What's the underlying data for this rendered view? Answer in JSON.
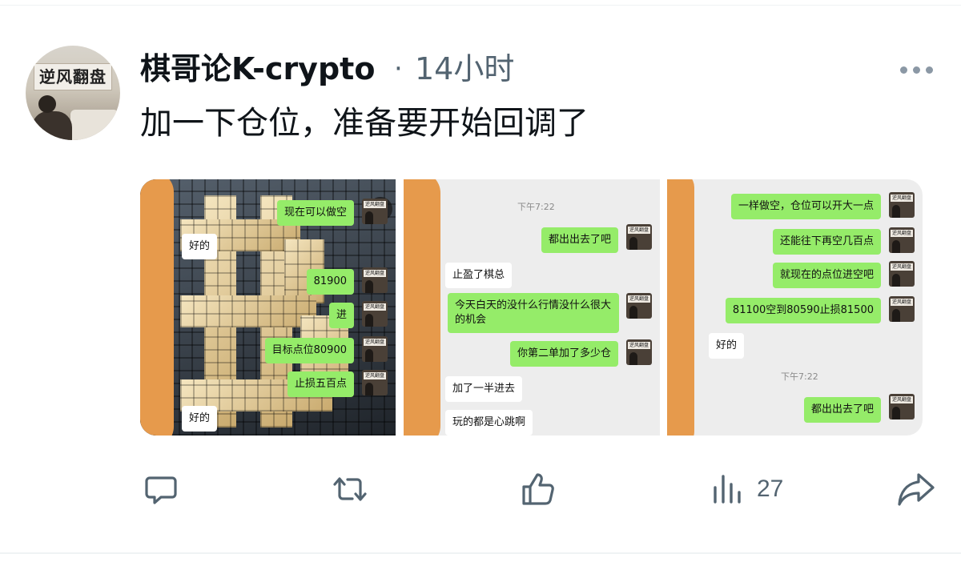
{
  "post": {
    "author_name": "棋哥论K-crypto",
    "separator": "·",
    "time": "14小时",
    "text": "加一下仓位，准备要开始回调了",
    "avatar_text": "逆风翻盘"
  },
  "images": [
    {
      "messages": [
        {
          "side": "right",
          "text": "现在可以做空"
        },
        {
          "side": "left",
          "text": "好的"
        },
        {
          "side": "right",
          "text": "81900"
        },
        {
          "side": "right",
          "text": "进"
        },
        {
          "side": "right",
          "text": "目标点位80900"
        },
        {
          "side": "right",
          "text": "止损五百点"
        },
        {
          "side": "left",
          "text": "好的"
        }
      ]
    },
    {
      "timestamp": "下午7:22",
      "messages": [
        {
          "side": "right",
          "text": "都出出去了吧"
        },
        {
          "side": "left",
          "text": "止盈了棋总"
        },
        {
          "side": "right",
          "text": "今天白天的没什么行情没什么很大的机会"
        },
        {
          "side": "right",
          "text": "你第二单加了多少仓"
        },
        {
          "side": "left",
          "text": "加了一半进去"
        },
        {
          "side": "left",
          "text": "玩的都是心跳啊"
        }
      ]
    },
    {
      "timestamp": "下午7:22",
      "messages": [
        {
          "side": "right",
          "text": "一样做空，仓位可以开大一点"
        },
        {
          "side": "right",
          "text": "还能往下再空几百点"
        },
        {
          "side": "right",
          "text": "就现在的点位进空吧"
        },
        {
          "side": "right",
          "text": "81100空到80590止损81500"
        },
        {
          "side": "left",
          "text": "好的"
        },
        {
          "side": "right",
          "text": "都出出去了吧"
        }
      ]
    }
  ],
  "actions": {
    "reply_icon": "reply-icon",
    "repost_icon": "repost-icon",
    "like_icon": "like-icon",
    "views_icon": "views-icon",
    "views_count": "27",
    "share_icon": "share-icon"
  },
  "colors": {
    "text_primary": "#0f1419",
    "text_secondary": "#536471",
    "wechat_green": "#95ec69",
    "smear_orange": "#e69a4c"
  }
}
